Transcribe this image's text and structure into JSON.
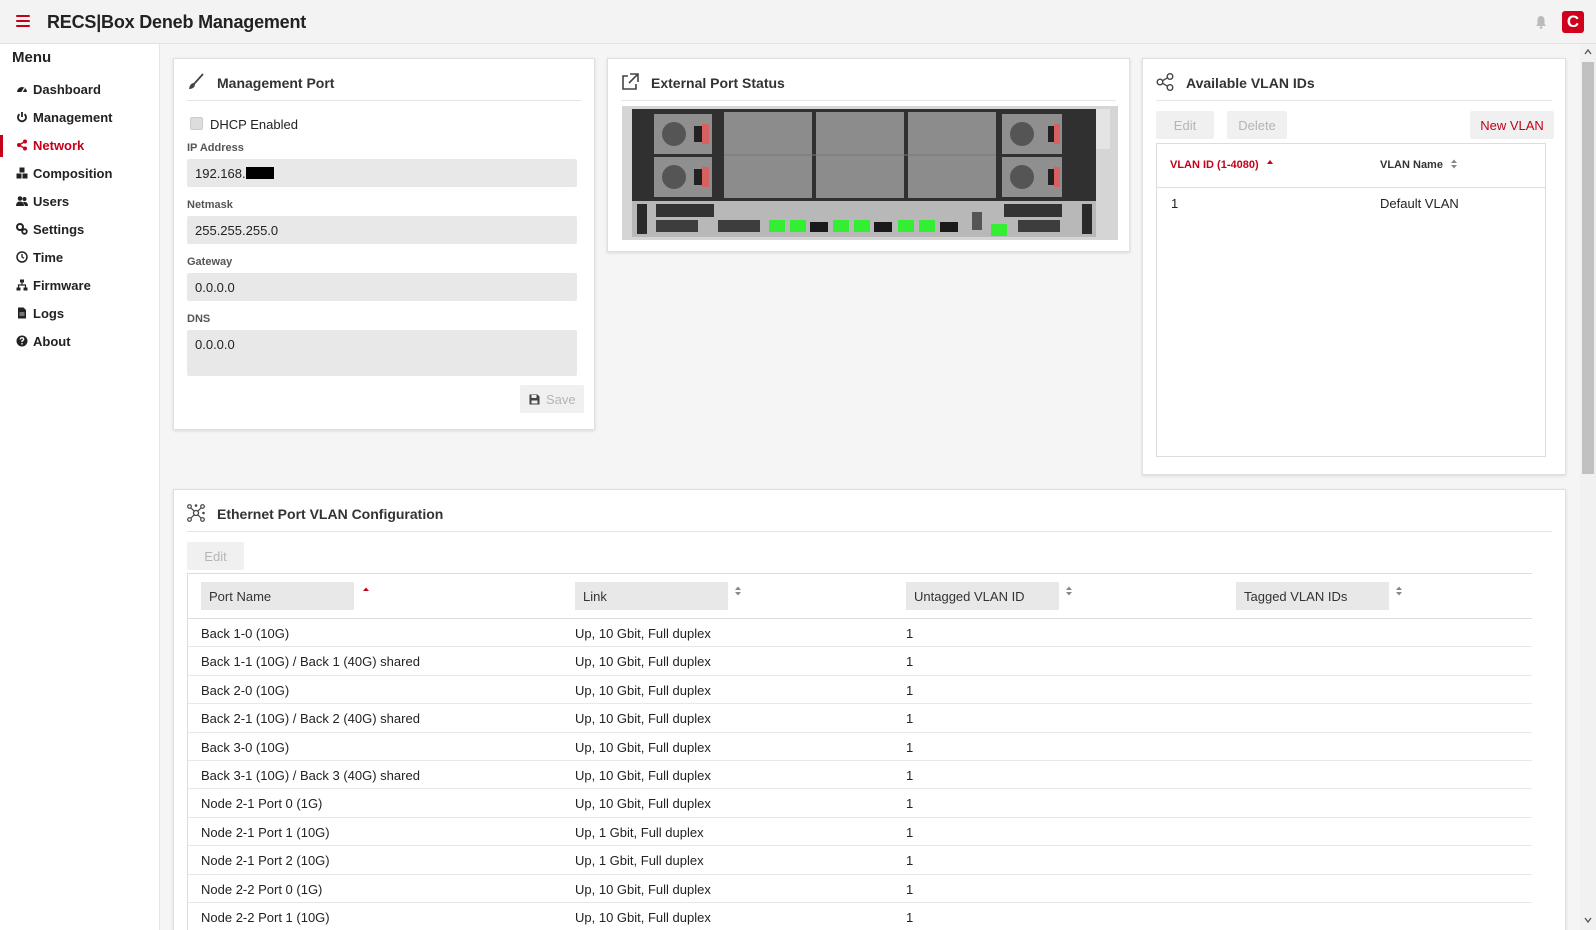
{
  "header": {
    "title": "RECS|Box Deneb Management",
    "logo_letter": "C"
  },
  "sidebar": {
    "title": "Menu",
    "items": [
      {
        "label": "Dashboard",
        "icon": "dashboard-icon"
      },
      {
        "label": "Management",
        "icon": "power-icon"
      },
      {
        "label": "Network",
        "icon": "share-icon",
        "active": true
      },
      {
        "label": "Composition",
        "icon": "cubes-icon"
      },
      {
        "label": "Users",
        "icon": "users-icon"
      },
      {
        "label": "Settings",
        "icon": "cogs-icon"
      },
      {
        "label": "Time",
        "icon": "clock-icon"
      },
      {
        "label": "Firmware",
        "icon": "sitemap-icon"
      },
      {
        "label": "Logs",
        "icon": "file-icon"
      },
      {
        "label": "About",
        "icon": "question-circle-icon"
      }
    ]
  },
  "management_port": {
    "title": "Management Port",
    "dhcp_label": "DHCP Enabled",
    "ip_label": "IP Address",
    "ip_value": "192.168.",
    "netmask_label": "Netmask",
    "netmask_value": "255.255.255.0",
    "gateway_label": "Gateway",
    "gateway_value": "0.0.0.0",
    "dns_label": "DNS",
    "dns_value": "0.0.0.0",
    "save_label": "Save"
  },
  "external_port": {
    "title": "External Port Status"
  },
  "vlans": {
    "title": "Available VLAN IDs",
    "edit_label": "Edit",
    "delete_label": "Delete",
    "new_label": "New VLAN",
    "col_id": "VLAN ID (1-4080)",
    "col_name": "VLAN Name",
    "rows": [
      {
        "id": "1",
        "name": "Default VLAN"
      }
    ]
  },
  "port_config": {
    "title": "Ethernet Port VLAN Configuration",
    "edit_label": "Edit",
    "columns": [
      "Port Name",
      "Link",
      "Untagged VLAN ID",
      "Tagged VLAN IDs"
    ],
    "rows": [
      {
        "port": "Back 1-0 (10G)",
        "link": "Up, 10 Gbit, Full duplex",
        "untagged": "1",
        "tagged": ""
      },
      {
        "port": "Back 1-1 (10G) / Back 1 (40G) shared",
        "link": "Up, 10 Gbit, Full duplex",
        "untagged": "1",
        "tagged": ""
      },
      {
        "port": "Back 2-0 (10G)",
        "link": "Up, 10 Gbit, Full duplex",
        "untagged": "1",
        "tagged": ""
      },
      {
        "port": "Back 2-1 (10G) / Back 2 (40G) shared",
        "link": "Up, 10 Gbit, Full duplex",
        "untagged": "1",
        "tagged": ""
      },
      {
        "port": "Back 3-0 (10G)",
        "link": "Up, 10 Gbit, Full duplex",
        "untagged": "1",
        "tagged": ""
      },
      {
        "port": "Back 3-1 (10G) / Back 3 (40G) shared",
        "link": "Up, 10 Gbit, Full duplex",
        "untagged": "1",
        "tagged": ""
      },
      {
        "port": "Node 2-1 Port 0 (1G)",
        "link": "Up, 10 Gbit, Full duplex",
        "untagged": "1",
        "tagged": ""
      },
      {
        "port": "Node 2-1 Port 1 (10G)",
        "link": "Up, 1 Gbit, Full duplex",
        "untagged": "1",
        "tagged": ""
      },
      {
        "port": "Node 2-1 Port 2 (10G)",
        "link": "Up, 1 Gbit, Full duplex",
        "untagged": "1",
        "tagged": ""
      },
      {
        "port": "Node 2-2 Port 0 (1G)",
        "link": "Up, 10 Gbit, Full duplex",
        "untagged": "1",
        "tagged": ""
      },
      {
        "port": "Node 2-2 Port 1 (10G)",
        "link": "Up, 10 Gbit, Full duplex",
        "untagged": "1",
        "tagged": ""
      }
    ]
  },
  "colors": {
    "accent": "#c4001a",
    "port_up": "#33ee33"
  }
}
